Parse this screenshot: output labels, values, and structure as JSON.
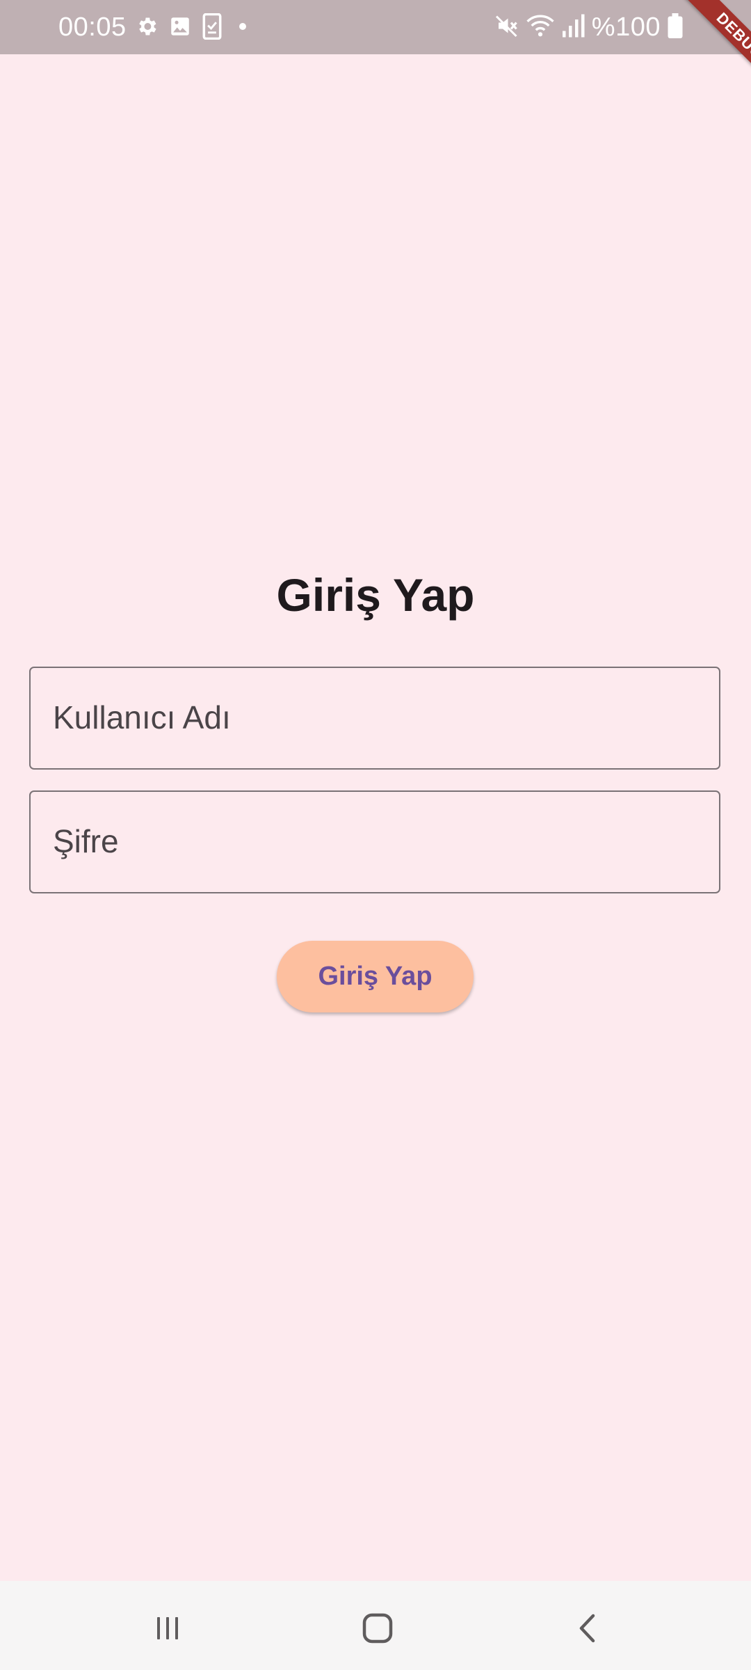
{
  "status_bar": {
    "time": "00:05",
    "battery": "%100",
    "left_icons": [
      "gear-icon",
      "image-icon",
      "phone-check-icon",
      "dot-icon"
    ],
    "right_icons": [
      "mute-icon",
      "wifi-icon",
      "signal-icon",
      "battery-icon"
    ]
  },
  "debug_banner": "DEBUG",
  "login": {
    "title": "Giriş Yap",
    "username_placeholder": "Kullanıcı Adı",
    "password_placeholder": "Şifre",
    "button_label": "Giriş Yap"
  },
  "nav_bar": {
    "icons": [
      "recents-icon",
      "home-icon",
      "back-icon"
    ]
  },
  "colors": {
    "background": "#fdeaee",
    "status_bar": "#bfb0b3",
    "button_bg": "#fdbf9f",
    "button_text": "#6a4e9c",
    "title_text": "#1f1a1d",
    "debug_ribbon": "#a3312b"
  }
}
